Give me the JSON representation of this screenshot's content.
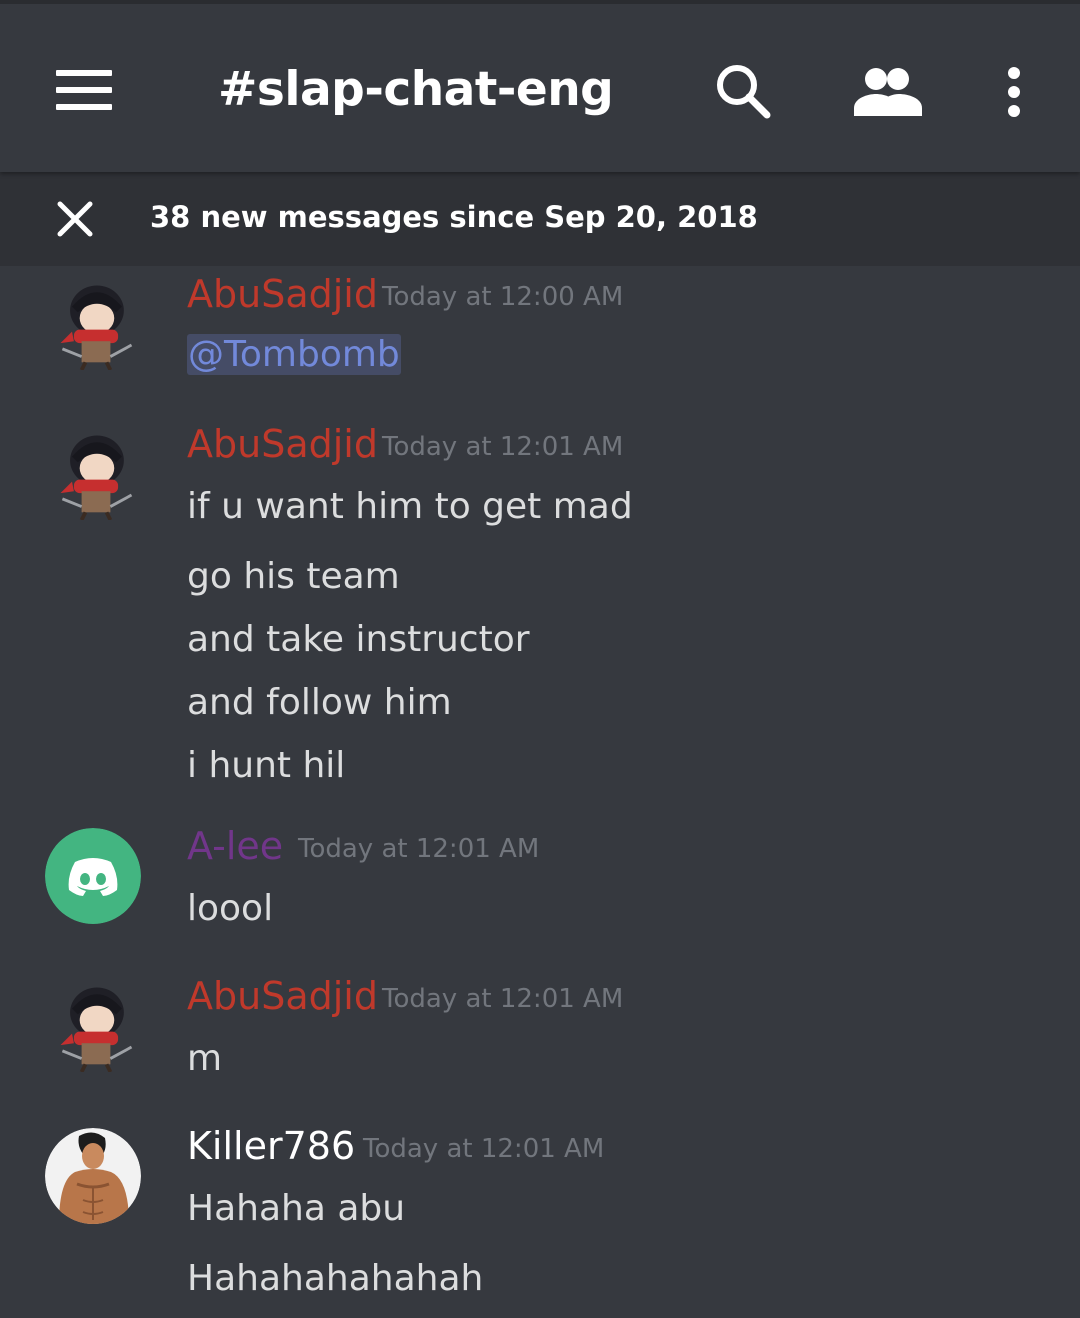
{
  "header": {
    "channel": "#slap-chat-eng",
    "icons": [
      "hamburger-menu-icon",
      "search-icon",
      "members-icon",
      "more-vertical-icon"
    ]
  },
  "banner": {
    "text": "38 new messages since Sep 20, 2018",
    "icon": "close-icon"
  },
  "colors": {
    "background": "#36393f",
    "abu": "#c0392b",
    "alee": "#71368a",
    "killer": "#ffffff",
    "mention": "#7289da",
    "timestamp": "#72767d",
    "discord_green": "#43b581"
  },
  "messages": [
    {
      "author": "AbuSadjid",
      "time": "Today at 12:00 AM",
      "lines": [
        "@Tombomb"
      ]
    },
    {
      "author": "AbuSadjid",
      "time": "Today at 12:01 AM",
      "lines": [
        "if u want him to get mad",
        "go his team",
        "and take instructor",
        "and follow him",
        "i hunt hil"
      ]
    },
    {
      "author": "A-lee",
      "time": "Today at 12:01 AM",
      "lines": [
        "loool"
      ]
    },
    {
      "author": "AbuSadjid",
      "time": "Today at 12:01 AM",
      "lines": [
        "m"
      ]
    },
    {
      "author": "Killer786",
      "time": "Today at 12:01 AM",
      "lines": [
        "Hahaha abu",
        "Hahahahahahah"
      ]
    }
  ]
}
